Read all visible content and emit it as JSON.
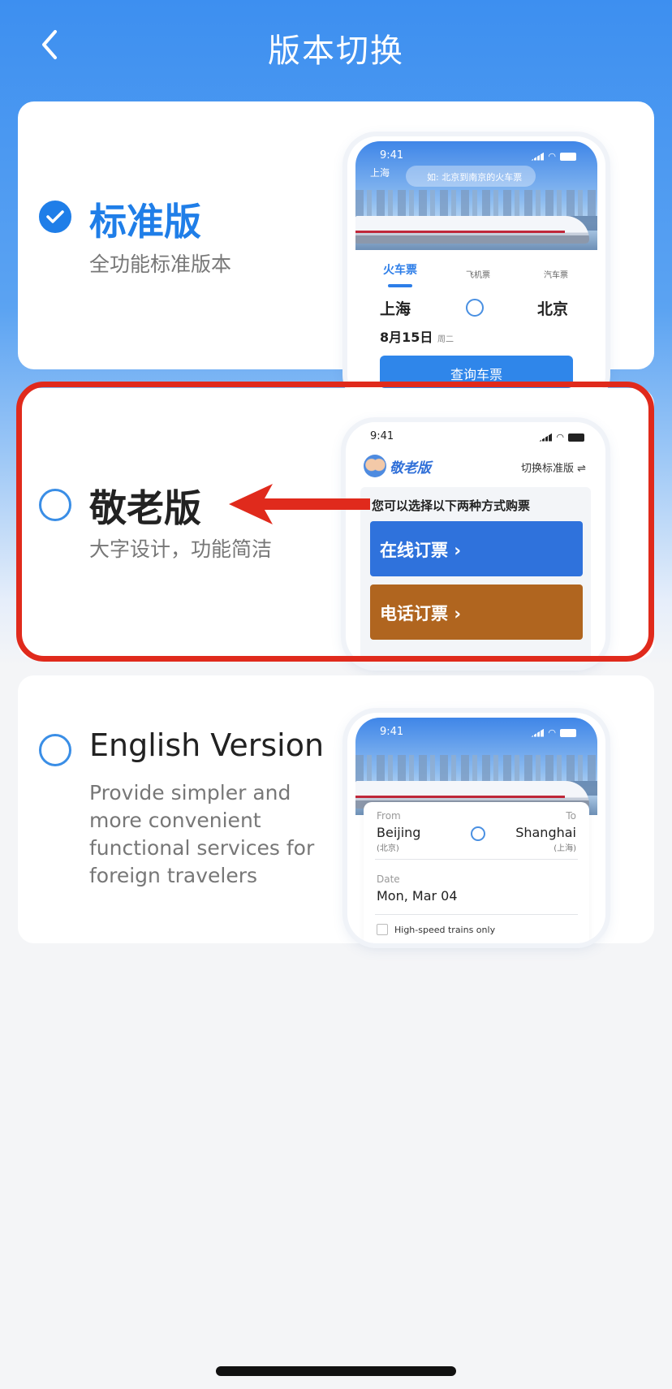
{
  "header": {
    "title": "版本切换",
    "back_icon": "chevron-left-icon"
  },
  "options": [
    {
      "id": "standard",
      "title": "标准版",
      "desc": "全功能标准版本",
      "selected": true,
      "title_color": "#1f7ee8"
    },
    {
      "id": "elder",
      "title": "敬老版",
      "desc": "大字设计，功能简洁",
      "selected": false,
      "title_color": "#222222"
    },
    {
      "id": "english",
      "title": "English Version",
      "desc_lines": [
        "Provide simpler and",
        "more convenient",
        "functional services for",
        "foreign travelers"
      ],
      "selected": false,
      "title_color": "#222222"
    }
  ],
  "preview_standard": {
    "time": "9:41",
    "city": "上海",
    "search_placeholder": "如: 北京到南京的火车票",
    "tabs": [
      "火车票",
      "飞机票",
      "汽车票"
    ],
    "from": "上海",
    "to": "北京",
    "date": "8月15日",
    "weekday": "周二",
    "button": "查询车票"
  },
  "preview_elder": {
    "time": "9:41",
    "logo": "敬老版",
    "switch": "切换标准版",
    "prompt": "您可以选择以下两种方式购票",
    "online": "在线订票",
    "phone": "电话订票"
  },
  "preview_english": {
    "time": "9:41",
    "from_label": "From",
    "to_label": "To",
    "from_city": "Beijing",
    "from_city_cn": "(北京)",
    "to_city": "Shanghai",
    "to_city_cn": "(上海)",
    "date_label": "Date",
    "date": "Mon, Mar 04",
    "checkbox": "High-speed trains only"
  },
  "colors": {
    "accent": "#1f7ee8",
    "annotation": "#e02a1c",
    "online_btn": "#2f72dc",
    "phone_btn": "#b0651f"
  }
}
